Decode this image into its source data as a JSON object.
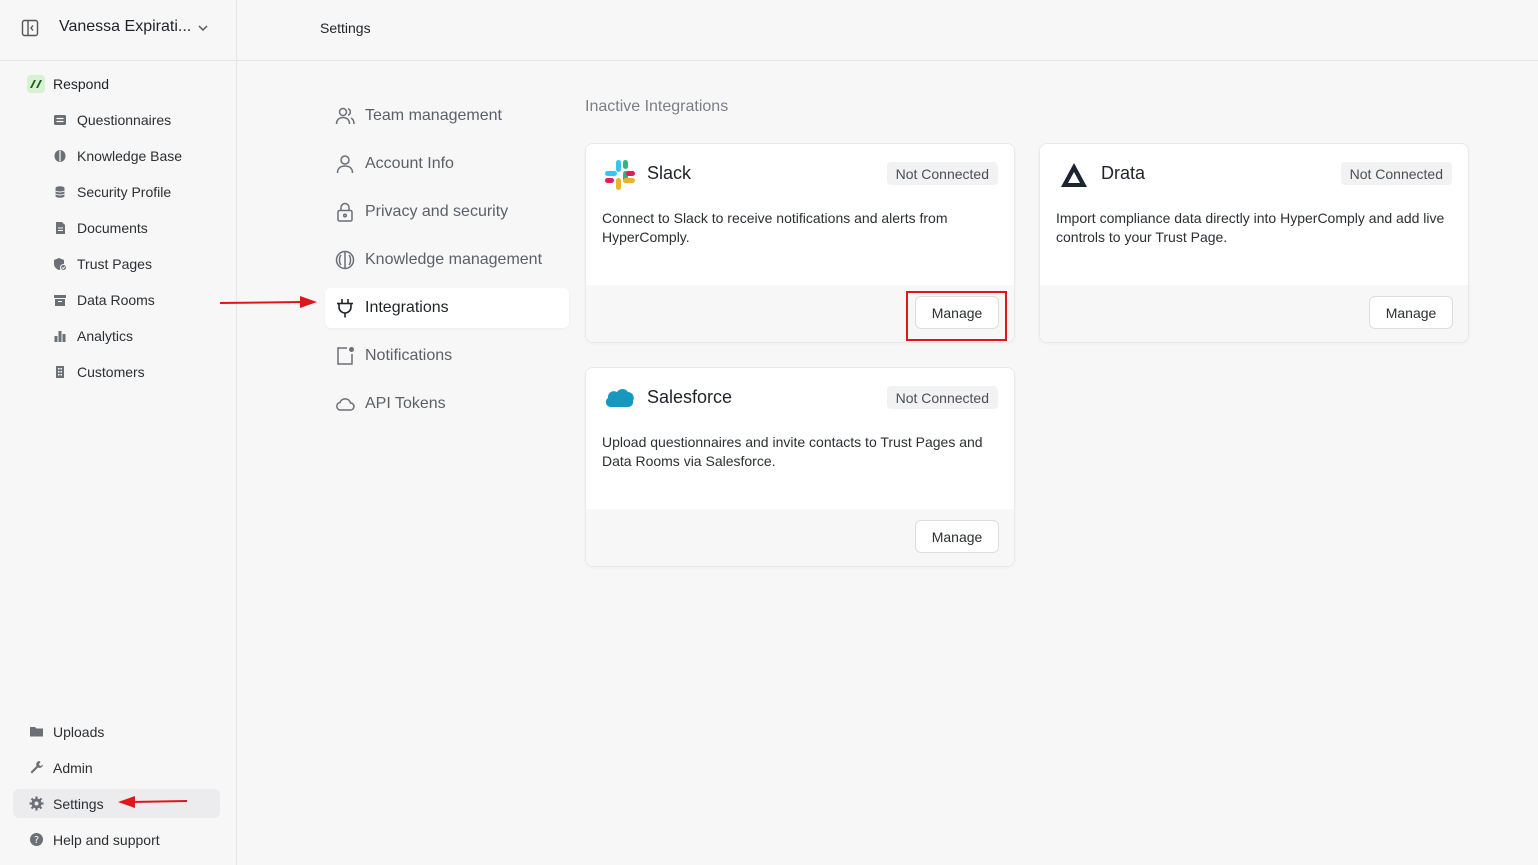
{
  "workspace": {
    "name": "Vanessa Expirati..."
  },
  "sidebar": {
    "section_label": "Respond",
    "items": [
      {
        "label": "Questionnaires",
        "icon": "list-icon"
      },
      {
        "label": "Knowledge Base",
        "icon": "brain-icon"
      },
      {
        "label": "Security Profile",
        "icon": "database-icon"
      },
      {
        "label": "Documents",
        "icon": "document-icon"
      },
      {
        "label": "Trust Pages",
        "icon": "shield-check-icon"
      },
      {
        "label": "Data Rooms",
        "icon": "archive-icon"
      },
      {
        "label": "Analytics",
        "icon": "bar-chart-icon"
      },
      {
        "label": "Customers",
        "icon": "building-icon"
      }
    ],
    "bottom": [
      {
        "label": "Uploads",
        "icon": "folder-icon"
      },
      {
        "label": "Admin",
        "icon": "wrench-icon"
      },
      {
        "label": "Settings",
        "icon": "gear-icon"
      },
      {
        "label": "Help and support",
        "icon": "help-icon"
      }
    ]
  },
  "topbar": {
    "title": "Settings"
  },
  "settings_nav": [
    {
      "label": "Team management",
      "icon": "users-icon"
    },
    {
      "label": "Account Info",
      "icon": "user-icon"
    },
    {
      "label": "Privacy and security",
      "icon": "lock-icon"
    },
    {
      "label": "Knowledge management",
      "icon": "brain-icon"
    },
    {
      "label": "Integrations",
      "icon": "plug-icon"
    },
    {
      "label": "Notifications",
      "icon": "bell-square-icon"
    },
    {
      "label": "API Tokens",
      "icon": "cloud-icon"
    }
  ],
  "main": {
    "section_title": "Inactive Integrations",
    "cards": [
      {
        "name": "Slack",
        "status": "Not Connected",
        "description": "Connect to Slack to receive notifications and alerts from HyperComply.",
        "button": "Manage",
        "logo": "slack-logo"
      },
      {
        "name": "Drata",
        "status": "Not Connected",
        "description": "Import compliance data directly into HyperComply and add live controls to your Trust Page.",
        "button": "Manage",
        "logo": "drata-logo"
      },
      {
        "name": "Salesforce",
        "status": "Not Connected",
        "description": "Upload questionnaires and invite contacts to Trust Pages and Data Rooms via Salesforce.",
        "button": "Manage",
        "logo": "salesforce-logo"
      }
    ]
  },
  "colors": {
    "annotation_red": "#e0161c",
    "accent_green": "#2f8a2f"
  }
}
